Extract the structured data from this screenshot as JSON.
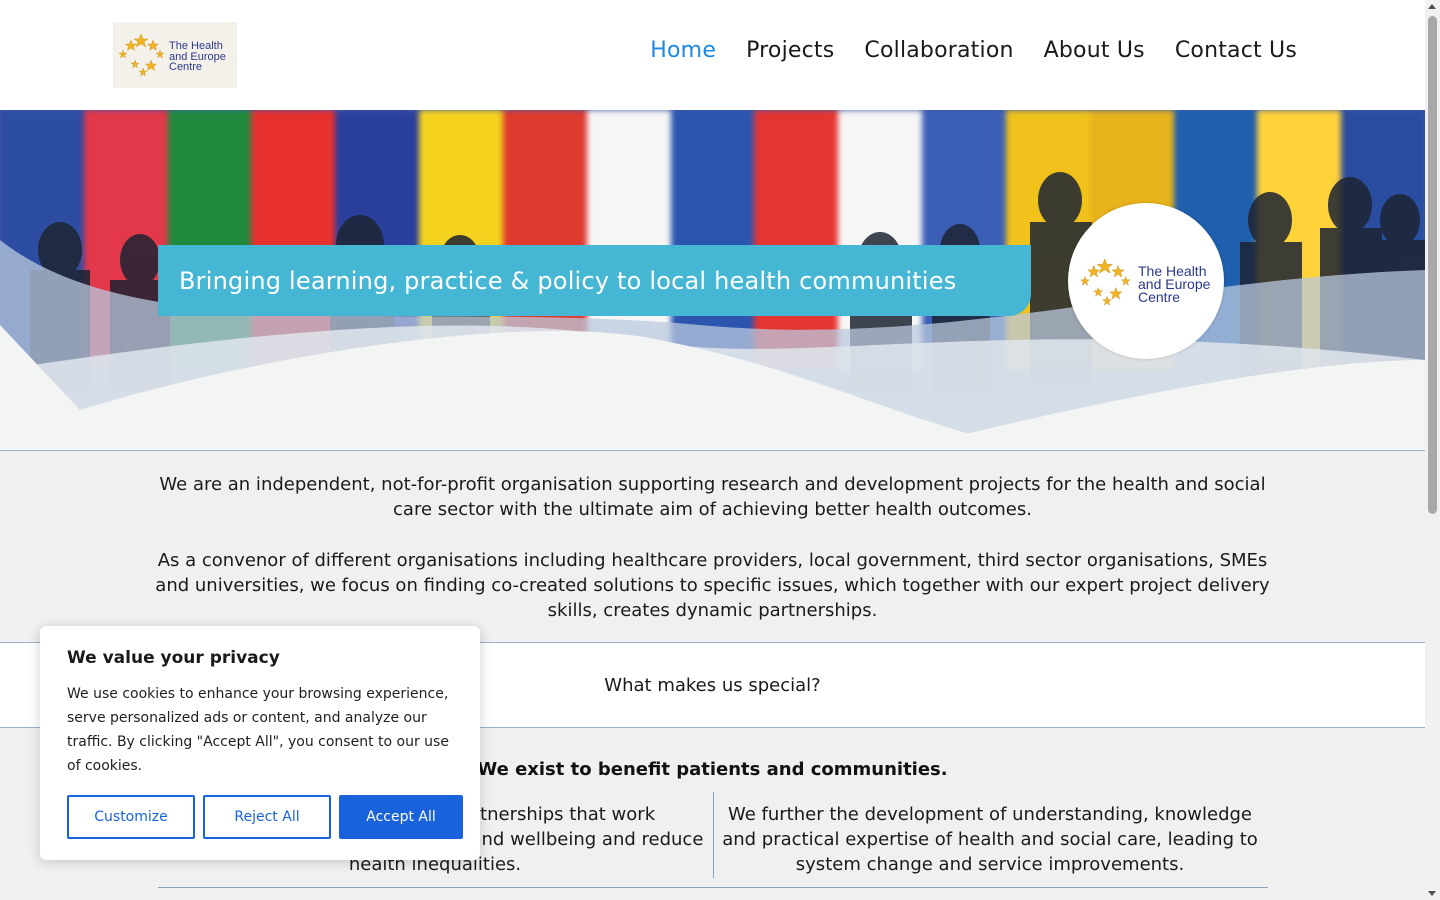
{
  "header": {
    "logo_text": [
      "The Health",
      "and Europe",
      "Centre"
    ],
    "nav": [
      {
        "label": "Home",
        "active": true
      },
      {
        "label": "Projects",
        "active": false
      },
      {
        "label": "Collaboration",
        "active": false
      },
      {
        "label": "About Us",
        "active": false
      },
      {
        "label": "Contact Us",
        "active": false
      }
    ]
  },
  "hero": {
    "tagline": "Bringing learning, practice & policy to local health communities",
    "badge_text": [
      "The Health",
      "and Europe",
      "Centre"
    ]
  },
  "intro": {
    "p1": "We are an independent, not-for-profit organisation supporting research and development projects for the health and social care sector with the ultimate aim of achieving better health outcomes.",
    "p2": "As a convenor of different organisations including healthcare providers, local government, third sector organisations, SMEs and universities, we focus on finding co-created solutions to specific issues, which together with our expert project delivery skills, creates dynamic partnerships."
  },
  "special": {
    "heading": "What makes us special?"
  },
  "benefits": {
    "heading": "We exist to benefit patients and communities.",
    "left": "We develop cross-agency partnerships that work collaboratively to improve health and wellbeing and reduce health inequalities.",
    "right": "We further the development of understanding, knowledge and practical expertise of health and social care, leading to system change and service improvements."
  },
  "cookie": {
    "title": "We value your privacy",
    "body": "We use cookies to enhance your browsing experience, serve personalized ads or content, and analyze our traffic. By clicking \"Accept All\", you consent to our use of cookies.",
    "customize": "Customize",
    "reject": "Reject All",
    "accept": "Accept All"
  },
  "colors": {
    "accent": "#1e88e5",
    "tagline_bg": "#45b6d3",
    "cookie_button": "#1863dc"
  }
}
